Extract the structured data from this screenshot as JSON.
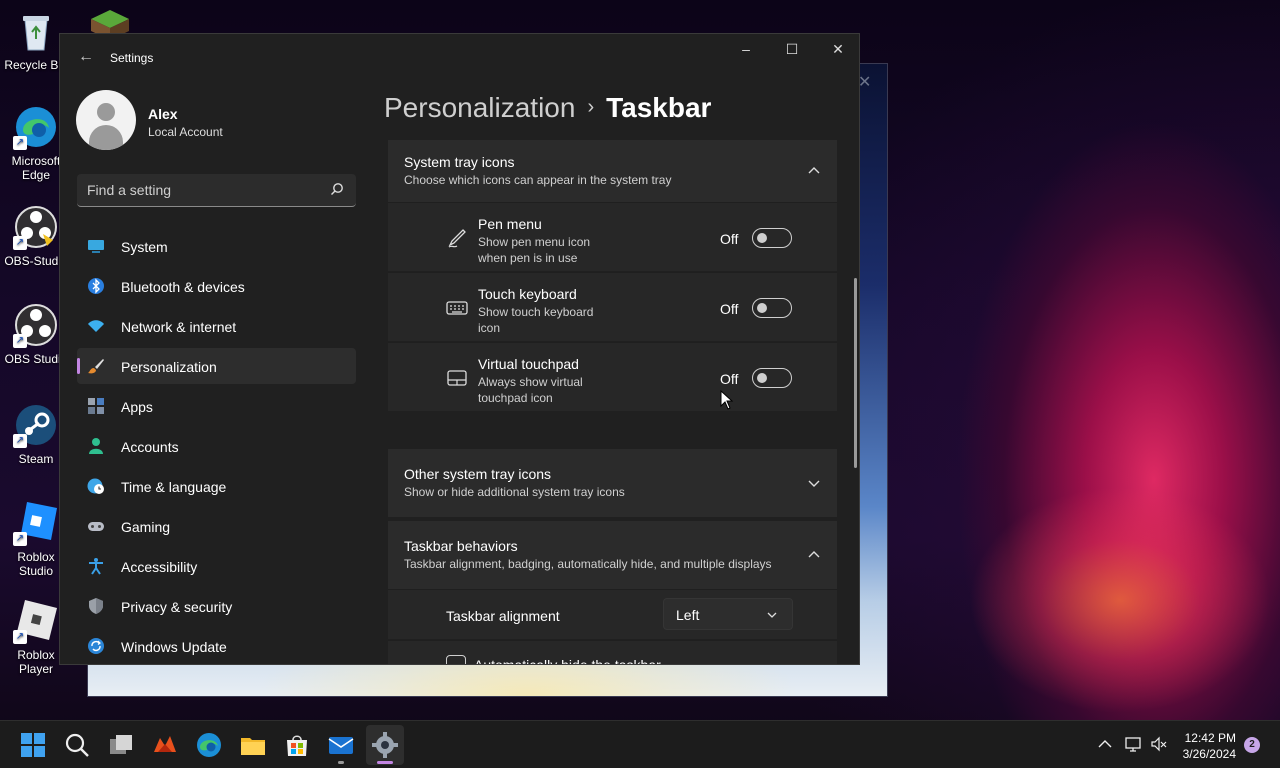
{
  "desktop": {
    "icons": [
      {
        "label": "Recycle Bin",
        "icon": "recycle-bin-icon"
      },
      {
        "label": "",
        "icon": "minecraft-grass-block-icon"
      },
      {
        "label": "Microsoft Edge",
        "icon": "edge-icon"
      },
      {
        "label": "OBS-Studio",
        "icon": "obs-icon"
      },
      {
        "label": "OBS Studio",
        "icon": "obs-icon"
      },
      {
        "label": "Steam",
        "icon": "steam-icon"
      },
      {
        "label": "Roblox Studio",
        "icon": "roblox-studio-icon"
      },
      {
        "label": "Roblox Player",
        "icon": "roblox-player-icon"
      }
    ]
  },
  "window": {
    "title": "Settings",
    "controls": {
      "minimize": "–",
      "maximize": "☐",
      "close": "✕"
    }
  },
  "profile": {
    "name": "Alex",
    "account": "Local Account"
  },
  "search": {
    "placeholder": "Find a setting"
  },
  "nav": {
    "items": [
      {
        "label": "System",
        "icon": "monitor-icon"
      },
      {
        "label": "Bluetooth & devices",
        "icon": "bluetooth-icon"
      },
      {
        "label": "Network & internet",
        "icon": "wifi-icon"
      },
      {
        "label": "Personalization",
        "icon": "brush-icon",
        "active": true
      },
      {
        "label": "Apps",
        "icon": "apps-icon"
      },
      {
        "label": "Accounts",
        "icon": "person-icon"
      },
      {
        "label": "Time & language",
        "icon": "globe-clock-icon"
      },
      {
        "label": "Gaming",
        "icon": "gamepad-icon"
      },
      {
        "label": "Accessibility",
        "icon": "accessibility-icon"
      },
      {
        "label": "Privacy & security",
        "icon": "shield-icon"
      },
      {
        "label": "Windows Update",
        "icon": "update-icon"
      }
    ]
  },
  "breadcrumb": {
    "parent": "Personalization",
    "separator": "›",
    "current": "Taskbar"
  },
  "sections": {
    "system_tray": {
      "title": "System tray icons",
      "subtitle": "Choose which icons can appear in the system tray",
      "expanded": true,
      "rows": [
        {
          "title": "Pen menu",
          "desc": "Show pen menu icon when pen is in use",
          "state": "Off",
          "icon": "pen-icon"
        },
        {
          "title": "Touch keyboard",
          "desc": "Show touch keyboard icon",
          "state": "Off",
          "icon": "keyboard-icon"
        },
        {
          "title": "Virtual touchpad",
          "desc": "Always show virtual touchpad icon",
          "state": "Off",
          "icon": "touchpad-icon"
        }
      ]
    },
    "other_tray": {
      "title": "Other system tray icons",
      "subtitle": "Show or hide additional system tray icons",
      "expanded": false
    },
    "behaviors": {
      "title": "Taskbar behaviors",
      "subtitle": "Taskbar alignment, badging, automatically hide, and multiple displays",
      "expanded": true,
      "alignment_label": "Taskbar alignment",
      "alignment_value": "Left",
      "autohide_label": "Automatically hide the taskbar",
      "autohide_checked": false
    }
  },
  "taskbar": {
    "apps": [
      "start-icon",
      "search-icon",
      "task-view-icon",
      "app-icon",
      "edge-icon",
      "file-explorer-icon",
      "store-icon",
      "mail-icon",
      "settings-icon"
    ],
    "clock_time": "12:42 PM",
    "clock_date": "3/26/2024",
    "notification_count": "2"
  },
  "colors": {
    "accent": "#c386e3",
    "window_bg": "#202020",
    "card_bg": "#2b2b2b"
  }
}
